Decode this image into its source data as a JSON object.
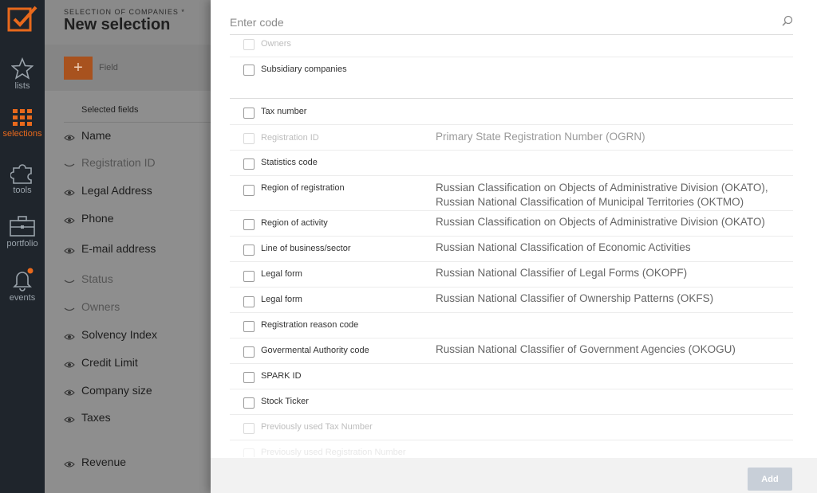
{
  "nav": {
    "items": [
      {
        "label": "lists",
        "icon": "star-icon"
      },
      {
        "label": "selections",
        "icon": "grid-icon",
        "active": true
      },
      {
        "label": "tools",
        "icon": "puzzle-icon"
      },
      {
        "label": "portfolio",
        "icon": "briefcase-icon"
      },
      {
        "label": "events",
        "icon": "bell-icon"
      }
    ]
  },
  "background": {
    "subtitle": "SELECTION OF COMPANIES *",
    "title": "New selection",
    "add_label": "+",
    "field_placeholder": "Field",
    "selected_fields_label": "Selected fields",
    "fields": [
      {
        "label": "Name"
      },
      {
        "label": "Registration ID"
      },
      {
        "label": "Legal Address"
      },
      {
        "label": "Phone"
      },
      {
        "label": "E-mail address"
      },
      {
        "label": "Status"
      },
      {
        "label": "Owners"
      },
      {
        "label": "Solvency Index"
      },
      {
        "label": "Credit Limit"
      },
      {
        "label": "Company size"
      },
      {
        "label": "Taxes"
      },
      {
        "label": "Revenue"
      }
    ]
  },
  "modal": {
    "search_placeholder": "Enter code",
    "rows": [
      {
        "name": "Owners",
        "desc": ""
      },
      {
        "name": "Subsidiary companies",
        "desc": ""
      },
      {
        "name": "Tax number",
        "desc": ""
      },
      {
        "name": "Registration ID",
        "desc": "Primary State Registration Number (OGRN)"
      },
      {
        "name": "Statistics code",
        "desc": ""
      },
      {
        "name": "Region of registration",
        "desc": "Russian Classification on Objects of Administrative Division (OKATO), Russian National Classification of Municipal Territories (OKTMO)"
      },
      {
        "name": "Region of activity",
        "desc": "Russian Classification on Objects of Administrative Division (OKATO)"
      },
      {
        "name": "Line of business/sector",
        "desc": "Russian National Classification of Economic Activities"
      },
      {
        "name": "Legal form",
        "desc": "Russian National Classifier of Legal Forms (OKOPF)"
      },
      {
        "name": "Legal form",
        "desc": "Russian National Classifier of Ownership Patterns (OKFS)"
      },
      {
        "name": "Registration reason code",
        "desc": ""
      },
      {
        "name": "Govermental Authority code",
        "desc": "Russian National Classifier of Government Agencies (OKOGU)"
      },
      {
        "name": "SPARK ID",
        "desc": ""
      },
      {
        "name": "Stock Ticker",
        "desc": ""
      },
      {
        "name": "Previously used Tax Number",
        "desc": ""
      },
      {
        "name": "Previously used Registration Number",
        "desc": ""
      }
    ],
    "add_button": "Add"
  },
  "colors": {
    "accent": "#e8691c",
    "nav_bg": "#1f252c"
  }
}
